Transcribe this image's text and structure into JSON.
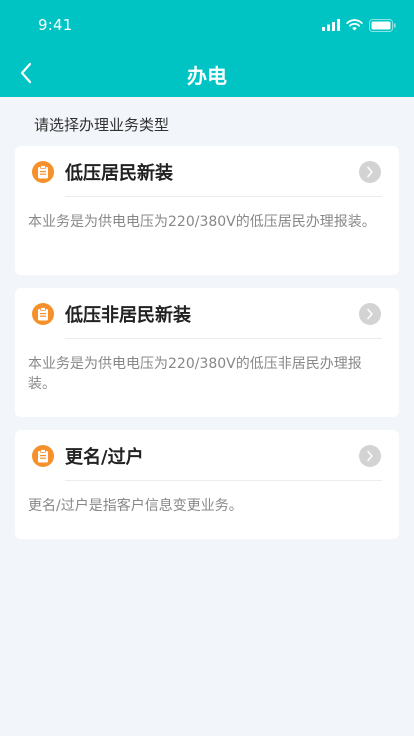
{
  "status_bar": {
    "time": "9:41"
  },
  "nav": {
    "title": "办电"
  },
  "hint": "请选择办理业务类型",
  "colors": {
    "accent": "#00c4c4",
    "icon_orange": "#f5902b",
    "arrow_gray": "#d3d3d3"
  },
  "cards": [
    {
      "title": "低压居民新装",
      "description": "本业务是为供电电压为220/380V的低压居民办理报装。",
      "icon": "clipboard-icon"
    },
    {
      "title": "低压非居民新装",
      "description": "本业务是为供电电压为220/380V的低压非居民办理报装。",
      "icon": "clipboard-icon"
    },
    {
      "title": "更名/过户",
      "description": "更名/过户是指客户信息变更业务。",
      "icon": "clipboard-icon"
    }
  ]
}
